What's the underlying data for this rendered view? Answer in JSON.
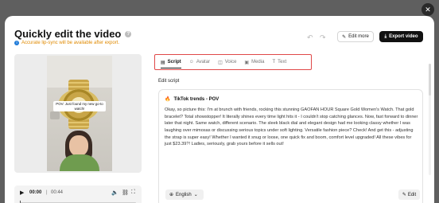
{
  "header": {
    "title": "Quickly edit the video",
    "info_icon_glyph": "?",
    "note": "Accurate lip-sync will be available after export.",
    "undo_glyph": "↶",
    "redo_glyph": "↷",
    "edit_more_label": "Edit more",
    "export_label": "Export video",
    "close_glyph": "✕"
  },
  "video": {
    "caption": "POV: Just found my new go-to watch!",
    "time_current": "00:00",
    "time_separator": "|",
    "time_total": "00:44",
    "progress": 0
  },
  "tabs": [
    {
      "label": "Script",
      "icon": "script-icon",
      "glyph": "▤",
      "active": true
    },
    {
      "label": "Avatar",
      "icon": "avatar-icon",
      "glyph": "☺",
      "active": false
    },
    {
      "label": "Voice",
      "icon": "voice-icon",
      "glyph": "◫",
      "active": false
    },
    {
      "label": "Media",
      "icon": "media-icon",
      "glyph": "▣",
      "active": false
    },
    {
      "label": "Text",
      "icon": "text-icon",
      "glyph": "T",
      "active": false
    }
  ],
  "editor": {
    "section_label": "Edit script",
    "script_title": "TikTok trends - POV",
    "script_text": "Okay, so picture this: I'm at brunch with friends, rocking this stunning GAOFAN HOUR Square Gold Women's Watch. That gold bracelet? Total showstopper! It literally shines every time light hits it - I couldn't stop catching glances. Now, fast forward to dinner later that night. Same watch, different scenario. The sleek black dial and elegant design had me looking classy whether I was laughing over mimosas or discussing serious topics under soft lighting. Versatile fashion piece? Check! And get this - adjusting the strap is super easy! Whether I wanted it snug or loose, one quick fix and boom, comfort level upgraded! All these vibes for just $23.39?! Ladies, seriously, grab yours before it sells out!",
    "language_label": "English",
    "edit_label": "Edit"
  },
  "colors": {
    "accent_red": "#e04848",
    "note_orange": "#e08a00",
    "info_blue": "#1e7bd9"
  }
}
